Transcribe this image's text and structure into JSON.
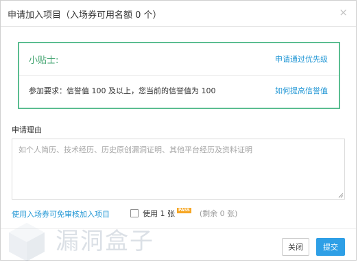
{
  "dialog": {
    "title": "申请加入项目（入场券可用名额 0 个）",
    "close_glyph": "×"
  },
  "tips": {
    "title": "小贴士:",
    "priority_link": "申请通过优先级",
    "requirement": "参加要求：信誉值 100 及以上，您当前的信誉值为 100",
    "improve_link": "如何提高信誉值",
    "border_color": "#5bbd91"
  },
  "reason": {
    "label": "申请理由",
    "value": "",
    "placeholder": "如个人简历、技术经历、历史原创漏洞证明、其他平台经历及资料证明"
  },
  "ticket": {
    "link": "使用入场券可免审核加入项目",
    "checked": false,
    "use_label": "使用 1 张",
    "pass_badge": "PASS",
    "remaining": "(剩余 0 张)"
  },
  "watermark": {
    "text": "漏洞盒子",
    "icon": "cube-logo-icon"
  },
  "buttons": {
    "close_label": "关闭",
    "submit_label": "提交",
    "submit_color": "#2e9fe6"
  }
}
